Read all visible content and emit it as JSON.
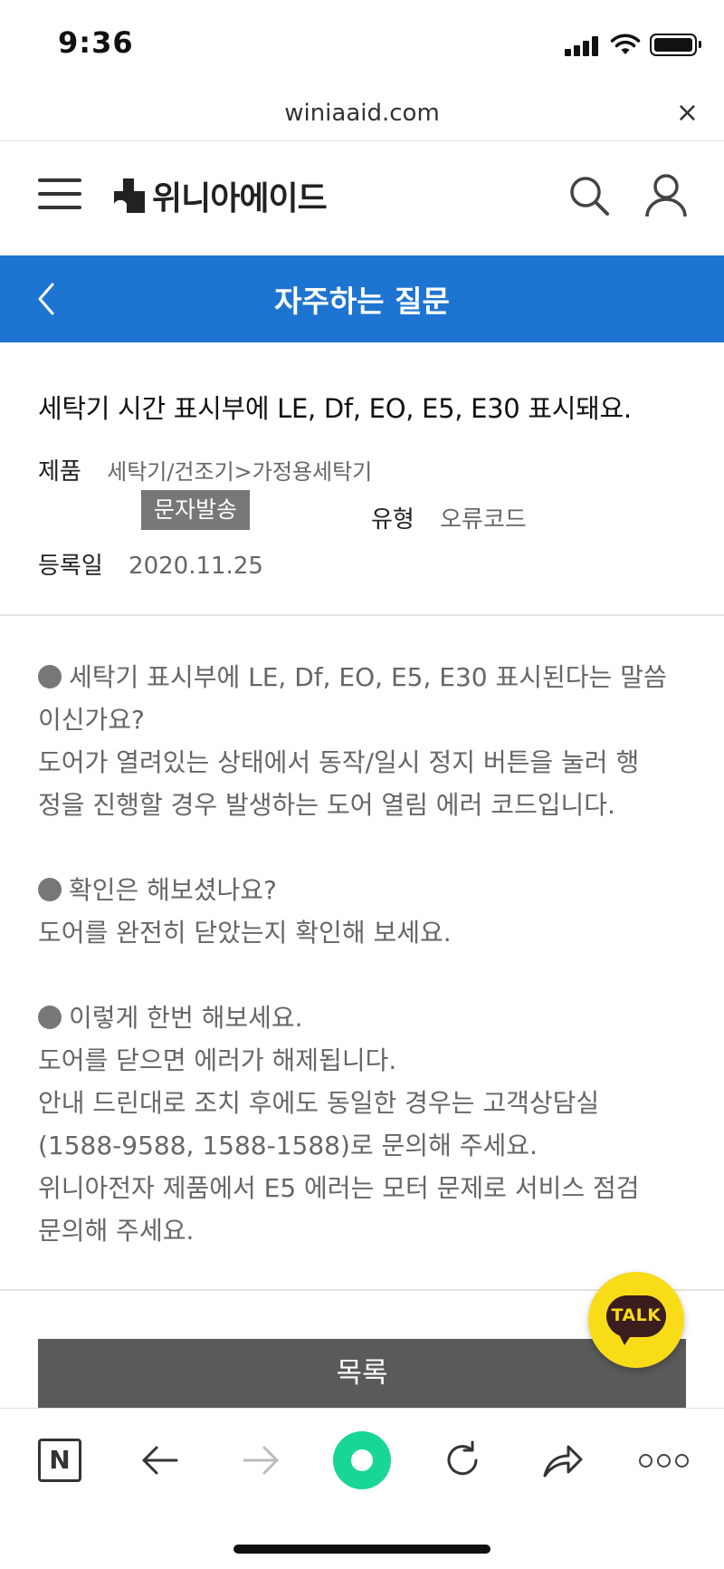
{
  "status_bar": {
    "time": "9:36"
  },
  "url_bar": {
    "url": "winiaaid.com",
    "close": "×"
  },
  "header": {
    "logo_text": "위니아에이드"
  },
  "title_band": {
    "title": "자주하는 질문"
  },
  "faq": {
    "question": "세탁기 시간 표시부에 LE, Df, EO, E5, E30 표시돼요.",
    "product_label": "제품",
    "product_value": "세탁기/건조기>가정용세탁기",
    "sms_button": "문자발송",
    "type_label": "유형",
    "type_value": "오류코드",
    "date_label": "등록일",
    "date_value": "2020.11.25"
  },
  "answer": {
    "lines": [
      "세탁기 표시부에 LE, Df, EO, E5, E30 표시된다는 말씀",
      "이신가요?",
      "도어가 열려있는 상태에서 동작/일시 정지 버튼을 눌러 행",
      "정을 진행할 경우 발생하는 도어 열림 에러 코드입니다.",
      "",
      "확인은 해보셨나요?",
      "도어를 완전히 닫았는지 확인해 보세요.",
      "",
      "이렇게 한번 해보세요.",
      "도어를 닫으면 에러가 해제됩니다.",
      "안내 드린대로 조치 후에도 동일한 경우는 고객상담실",
      "(1588-9588, 1588-1588)로 문의해 주세요.",
      "위니아전자 제품에서 E5 에러는 모터 문제로 서비스 점검",
      "문의해 주세요."
    ]
  },
  "list_button": "목록",
  "talk_button": "TALK",
  "browser_bar": {
    "n_label": "N"
  },
  "colors": {
    "accent": "#1e74d1",
    "talk": "#f9dc18",
    "green": "#18d694",
    "button": "#5a5a5a"
  }
}
